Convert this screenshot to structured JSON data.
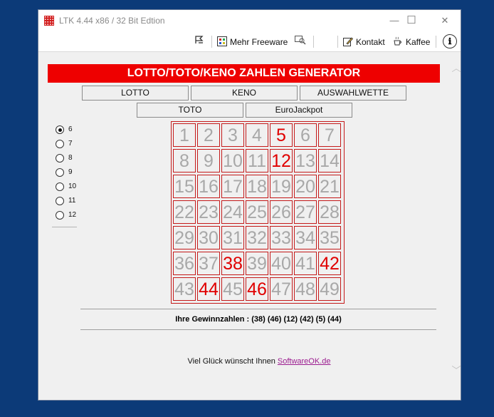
{
  "window": {
    "title": "LTK 4.44 x86 / 32 Bit Edtion",
    "controls": {
      "minimize": "—",
      "maximize": "☐",
      "close": "✕"
    }
  },
  "menu": {
    "mehr_freeware": "Mehr Freeware",
    "kontakt": "Kontakt",
    "kaffee": "Kaffee",
    "info_symbol": "ℹ"
  },
  "banner": "LOTTO/TOTO/KENO ZAHLEN GENERATOR",
  "games": [
    "LOTTO",
    "KENO",
    "AUSWAHLWETTE",
    "TOTO",
    "EuroJackpot"
  ],
  "picks": {
    "options": [
      "6",
      "7",
      "8",
      "9",
      "10",
      "11",
      "12"
    ],
    "selected": "6"
  },
  "grid": {
    "numbers": [
      1,
      2,
      3,
      4,
      5,
      6,
      7,
      8,
      9,
      10,
      11,
      12,
      13,
      14,
      15,
      16,
      17,
      18,
      19,
      20,
      21,
      22,
      23,
      24,
      25,
      26,
      27,
      28,
      29,
      30,
      31,
      32,
      33,
      34,
      35,
      36,
      37,
      38,
      39,
      40,
      41,
      42,
      43,
      44,
      45,
      46,
      47,
      48,
      49
    ],
    "highlighted": [
      5,
      12,
      38,
      42,
      44,
      46
    ]
  },
  "result": "Ihre Gewinnzahlen : (38) (46) (12) (42) (5) (44)",
  "footer": {
    "text": "Viel Glück wünscht Ihnen",
    "link": "SoftwareOK.de"
  },
  "colors": {
    "accent": "#ee0000",
    "hit": "#e00000",
    "number": "#a8a8a8",
    "desktop": "#0c3a78"
  },
  "icons": [
    "app-icon",
    "flag-icon",
    "grid-icon",
    "search-icon",
    "pencil-icon",
    "coffee-icon",
    "info-icon"
  ]
}
